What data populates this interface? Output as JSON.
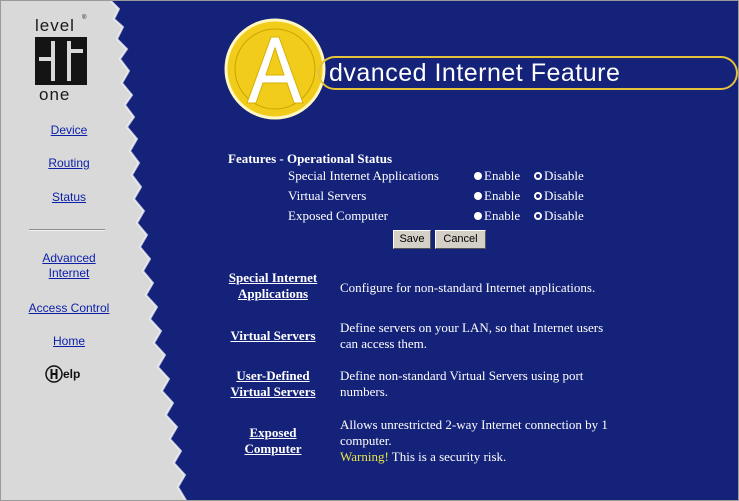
{
  "logo": {
    "top_text": "level",
    "registered": "®",
    "bottom_text": "one"
  },
  "nav": {
    "device": "Device",
    "routing": "Routing",
    "status": "Status",
    "advanced_line1": "Advanced",
    "advanced_line2": "Internet",
    "access_control": "Access Control",
    "home": "Home",
    "help": "elp"
  },
  "banner": {
    "initial": "A",
    "title": "dvanced Internet Feature"
  },
  "status_panel": {
    "heading": "Features - Operational Status",
    "enable_label": "Enable",
    "disable_label": "Disable",
    "features": [
      {
        "label": "Special Internet Applications",
        "state": "Disable"
      },
      {
        "label": "Virtual Servers",
        "state": "Disable"
      },
      {
        "label": "Exposed Computer",
        "state": "Disable"
      }
    ],
    "save_label": "Save",
    "cancel_label": "Cancel"
  },
  "feature_list": [
    {
      "link_line1": "Special Internet",
      "link_line2": "Applications",
      "desc_line1": "Configure for non-standard Internet applications.",
      "desc_line2": ""
    },
    {
      "link_line1": "Virtual Servers",
      "link_line2": "",
      "desc_line1": "Define servers on your LAN, so that Internet users",
      "desc_line2": "can access them."
    },
    {
      "link_line1": "User-Defined",
      "link_line2": "Virtual Servers",
      "desc_line1": "Define non-standard Virtual Servers using port",
      "desc_line2": "numbers."
    },
    {
      "link_line1": "Exposed",
      "link_line2": "Computer",
      "desc_line1": "Allows unrestricted 2-way Internet connection by 1",
      "desc_line2": "computer.",
      "warning_word": "Warning!",
      "warning_text": " This is a security risk."
    }
  ],
  "colors": {
    "background": "#14227a",
    "sidebar": "#d9d9d9",
    "accent_yellow": "#f2cc1a",
    "warning": "#e8e64a",
    "link": "#0b1fa8"
  }
}
